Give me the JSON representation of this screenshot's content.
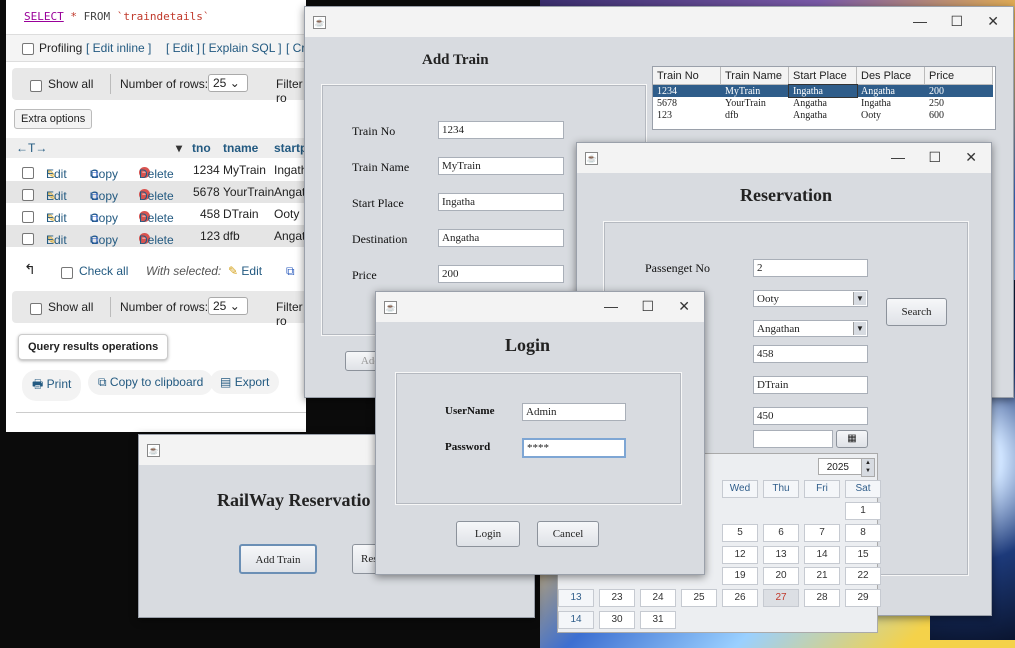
{
  "phpmyadmin": {
    "sql_select": "SELECT",
    "sql_star": "*",
    "sql_from": "FROM",
    "sql_table": "`traindetails`",
    "profiling": "Profiling",
    "edit_inline": "[ Edit inline ]",
    "edit": "[ Edit ]",
    "explain_sql": "[ Explain SQL ]",
    "create_php": "[ Create PHP",
    "show_all": "Show all",
    "num_rows_label": "Number of rows:",
    "num_rows_value": "25",
    "filter": "Filter ro",
    "extra_options": "Extra options",
    "arrows": "←T→",
    "columns": [
      "tno",
      "tname",
      "startp"
    ],
    "row_actions": {
      "edit": "Edit",
      "copy": "Copy",
      "delete": "Delete"
    },
    "rows": [
      {
        "tno": "1234",
        "tname": "MyTrain",
        "startp": "Ingath"
      },
      {
        "tno": "5678",
        "tname": "YourTrain",
        "startp": "Angath"
      },
      {
        "tno": "458",
        "tname": "DTrain",
        "startp": "Ooty"
      },
      {
        "tno": "123",
        "tname": "dfb",
        "startp": "Angath"
      }
    ],
    "check_all": "Check all",
    "with_selected": "With selected:",
    "with_selected_edit": "Edit",
    "query_results_ops": "Query results operations",
    "print": "Print",
    "copy_clipboard": "Copy to clipboard",
    "export": "Export"
  },
  "add_train": {
    "title": "Add Train",
    "train_no_label": "Train No",
    "train_no_value": "1234",
    "train_name_label": "Train Name",
    "train_name_value": "MyTrain",
    "start_place_label": "Start Place",
    "start_place_value": "Ingatha",
    "destination_label": "Destination",
    "destination_value": "Angatha",
    "price_label": "Price",
    "price_value": "200",
    "add_button": "Add T",
    "table": {
      "headers": [
        "Train No",
        "Train Name",
        "Start Place",
        "Des Place",
        "Price"
      ],
      "rows": [
        [
          "1234",
          "MyTrain",
          "Ingatha",
          "Angatha",
          "200"
        ],
        [
          "5678",
          "YourTrain",
          "Angatha",
          "Ingatha",
          "250"
        ],
        [
          "123",
          "dfb",
          "Angatha",
          "Ooty",
          "600"
        ]
      ]
    }
  },
  "reservation": {
    "title": "Reservation",
    "passenger_no_label": "Passenget No",
    "passenger_no_value": "2",
    "combo1": "Ooty",
    "combo2": "Angathan",
    "search_button": "Search",
    "field_train_no": "458",
    "field_train_name": "DTrain",
    "field_price": "450",
    "field_date": ""
  },
  "calendar": {
    "year": "2025",
    "weekdays": [
      "Wed",
      "Thu",
      "Fri",
      "Sat"
    ],
    "days": [
      "1",
      "5",
      "6",
      "7",
      "8",
      "12",
      "13",
      "14",
      "15",
      "19",
      "20",
      "21",
      "22",
      "13",
      "23",
      "24",
      "25",
      "26",
      "27",
      "28",
      "29",
      "14",
      "30",
      "31"
    ]
  },
  "main_window": {
    "title": "RailWay Reservatio",
    "add_train_button": "Add Train",
    "res_button": "Res"
  },
  "login": {
    "title": "Login",
    "username_label": "UserName",
    "username_value": "Admin",
    "password_label": "Password",
    "password_value": "****",
    "login_button": "Login",
    "cancel_button": "Cancel"
  }
}
